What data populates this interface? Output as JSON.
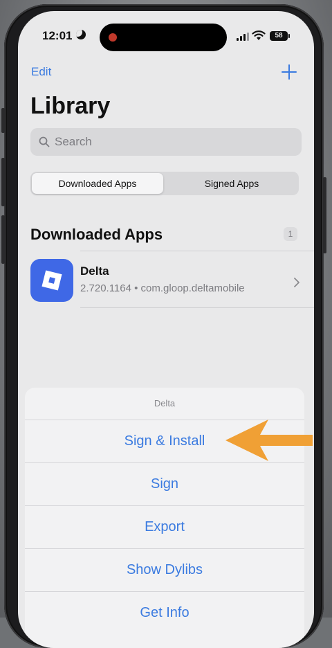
{
  "status_bar": {
    "time": "12:01",
    "battery": "58"
  },
  "nav": {
    "edit_label": "Edit",
    "add_icon": "plus-icon"
  },
  "page": {
    "title": "Library"
  },
  "search": {
    "placeholder": "Search"
  },
  "segments": {
    "active": "Downloaded Apps",
    "inactive": "Signed Apps"
  },
  "section": {
    "title": "Downloaded Apps",
    "count": "1"
  },
  "app": {
    "name": "Delta",
    "meta": "2.720.1164 • com.gloop.deltamobile",
    "icon_color": "#3f68e6"
  },
  "action_sheet": {
    "title": "Delta",
    "items": [
      "Sign & Install",
      "Sign",
      "Export",
      "Show Dylibs",
      "Get Info"
    ]
  },
  "annotation": {
    "arrow_color": "#f0a035",
    "points_to": "Sign & Install"
  },
  "colors": {
    "accent": "#3b7be0",
    "background": "#e9e9ea"
  }
}
